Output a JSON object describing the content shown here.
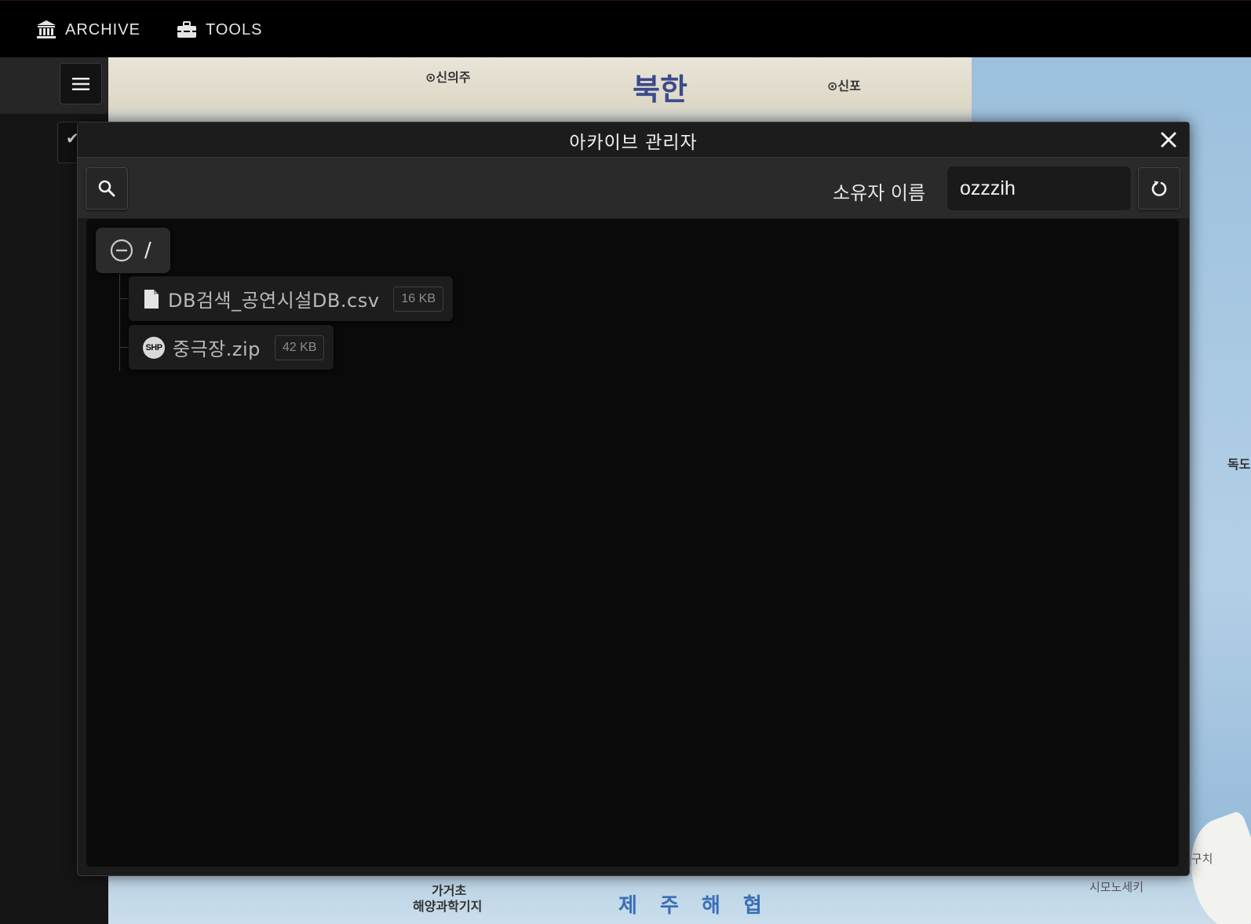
{
  "nav": {
    "items": [
      {
        "label": "ARCHIVE",
        "icon": "bank-icon"
      },
      {
        "label": "TOOLS",
        "icon": "toolbox-icon"
      }
    ]
  },
  "map": {
    "labels": {
      "sinuiju": "⊙신의주",
      "bukhan": "북한",
      "sinpo": "⊙신포",
      "dokdo": "독도",
      "gageocho": "가거초",
      "ocean_base": "해양과학기지",
      "jeju_strait": "제 주 해 협",
      "shimonoseki": "시모노세키",
      "kitakyushu": "키구치"
    }
  },
  "dialog": {
    "title": "아카이브 관리자",
    "owner_label": "소유자 이름",
    "owner_value": "ozzzih"
  },
  "tree": {
    "root_label": "/",
    "files": [
      {
        "name": "DB검색_공연시설DB.csv",
        "size": "16 KB",
        "icon": "file-icon"
      },
      {
        "name": "중극장.zip",
        "size": "42 KB",
        "icon": "shp-icon",
        "badge": "SHP"
      }
    ]
  }
}
